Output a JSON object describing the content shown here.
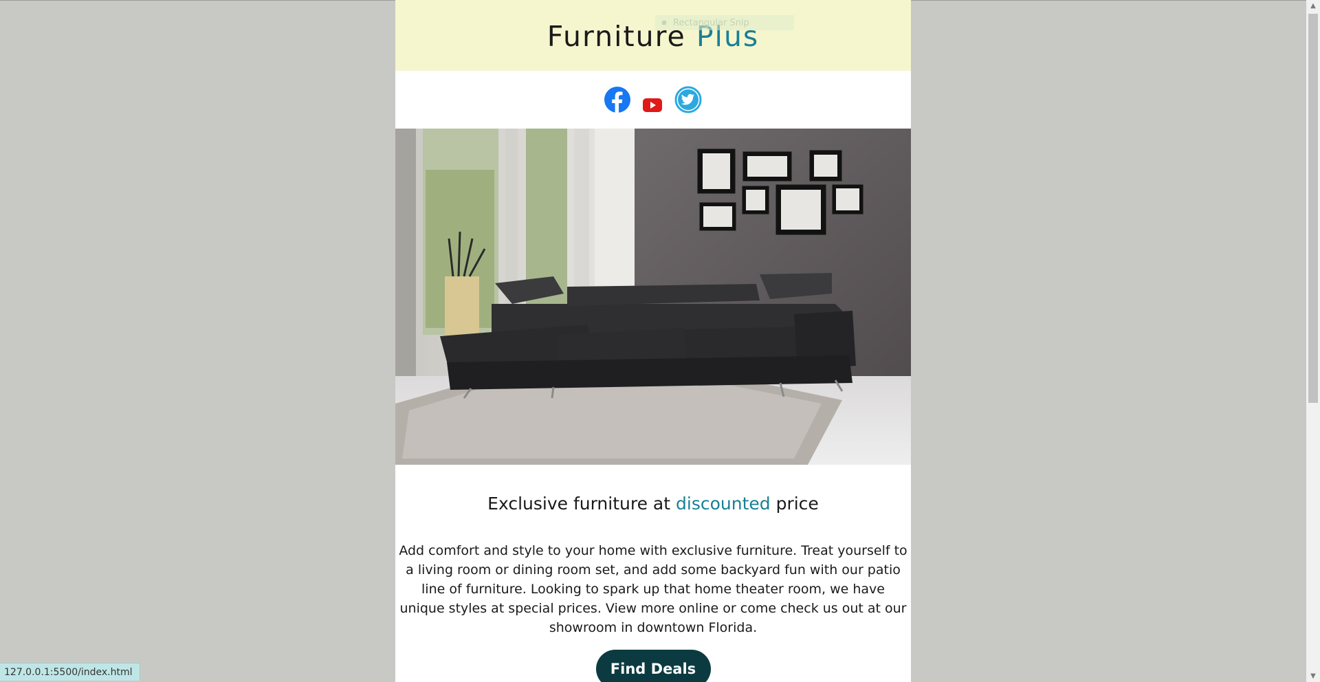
{
  "header": {
    "title_main": "Furniture",
    "title_accent": "Plus"
  },
  "social": {
    "icons": [
      "facebook-icon",
      "youtube-icon",
      "twitter-icon"
    ]
  },
  "content": {
    "headline_part1": "Exclusive furniture at",
    "headline_accent": "discounted",
    "headline_part2": "price",
    "body": "Add comfort and style to your home with exclusive furniture. Treat yourself to a living room or dining room set, and add some backyard fun with our patio line of furniture. Looking to spark up that home theater room, we have unique styles at special prices. View more online or come check us out at our showroom in downtown Florida.",
    "cta_label": "Find Deals"
  },
  "overlay": {
    "ghost_tooltip": "Rectangular Snip"
  },
  "status": {
    "url": "127.0.0.1:5500/index.html"
  },
  "colors": {
    "accent": "#1a7f96",
    "header_bg": "#f5f6ce",
    "cta_bg": "#0b3b40",
    "page_bg": "#c8c9c5"
  }
}
